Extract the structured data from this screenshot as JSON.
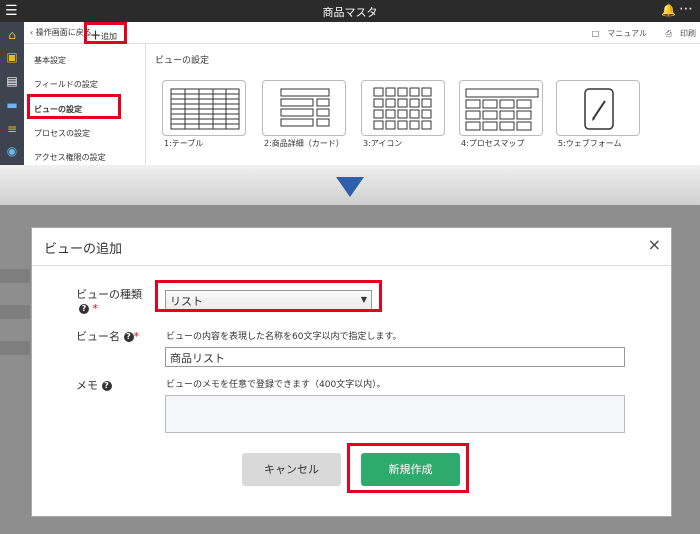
{
  "app": {
    "title": "商品マスタ"
  },
  "toolbar": {
    "back_label": "操作画面に戻る",
    "add_label": "追加",
    "manual_label": "マニュアル",
    "print_label": "印刷"
  },
  "subnav": {
    "items": [
      "基本設定",
      "フィールドの設定",
      "ビューの設定",
      "プロセスの設定",
      "アクセス権限の設定"
    ]
  },
  "view_panel": {
    "header": "ビューの設定",
    "tiles": [
      {
        "label": "1:テーブル",
        "icon": "table-icon"
      },
      {
        "label": "2:商品詳細（カード）",
        "icon": "card-icon"
      },
      {
        "label": "3:アイコン",
        "icon": "icon-grid-icon"
      },
      {
        "label": "4:プロセスマップ",
        "icon": "process-map-icon"
      },
      {
        "label": "5:ウェブフォーム",
        "icon": "webform-icon"
      }
    ]
  },
  "dialog": {
    "title": "ビューの追加",
    "close": "×",
    "view_type_label": "ビューの種類",
    "view_type_value": "リスト",
    "view_name_label": "ビュー名",
    "view_name_hint": "ビューの内容を表現した名称を60文字以内で指定します。",
    "view_name_value": "商品リスト",
    "memo_label": "メモ",
    "memo_hint": "ビューのメモを任意で登録できます（400文字以内）。",
    "memo_value": "",
    "cancel_label": "キャンセル",
    "create_label": "新規作成",
    "required_mark": "*",
    "help_mark": "?"
  },
  "colors": {
    "accent_green": "#2dab6d",
    "highlight_red": "#e6001f",
    "arrow_blue": "#2e5fa8"
  }
}
